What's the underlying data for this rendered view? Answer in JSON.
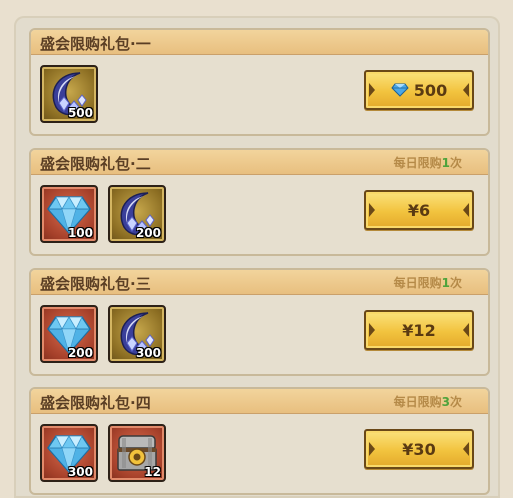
{
  "packs": [
    {
      "title": "盛会限购礼包·一",
      "limit": null,
      "items": [
        {
          "icon": "crescent-crystal-icon",
          "qty": "500",
          "frame": "gold"
        }
      ],
      "price": {
        "icon": "diamond-icon",
        "text": "500"
      }
    },
    {
      "title": "盛会限购礼包·二",
      "limit": {
        "prefix": "每日限购",
        "count": "1",
        "suffix": "次"
      },
      "items": [
        {
          "icon": "blue-diamond-icon",
          "qty": "100",
          "frame": "red"
        },
        {
          "icon": "crescent-crystal-icon",
          "qty": "200",
          "frame": "gold"
        }
      ],
      "price": {
        "icon": null,
        "text": "¥6"
      }
    },
    {
      "title": "盛会限购礼包·三",
      "limit": {
        "prefix": "每日限购",
        "count": "1",
        "suffix": "次"
      },
      "items": [
        {
          "icon": "blue-diamond-icon",
          "qty": "200",
          "frame": "red"
        },
        {
          "icon": "crescent-crystal-icon",
          "qty": "300",
          "frame": "gold"
        }
      ],
      "price": {
        "icon": null,
        "text": "¥12"
      }
    },
    {
      "title": "盛会限购礼包·四",
      "limit": {
        "prefix": "每日限购",
        "count": "3",
        "suffix": "次"
      },
      "items": [
        {
          "icon": "blue-diamond-icon",
          "qty": "300",
          "frame": "red"
        },
        {
          "icon": "treasure-chest-icon",
          "qty": "12",
          "frame": "red"
        }
      ],
      "price": {
        "icon": null,
        "text": "¥30"
      }
    }
  ],
  "colors": {
    "panel_header": "#e8bf7f",
    "limit_text": "#b58a48",
    "limit_count": "#4ea33c",
    "price_button": "#f2c33e"
  }
}
